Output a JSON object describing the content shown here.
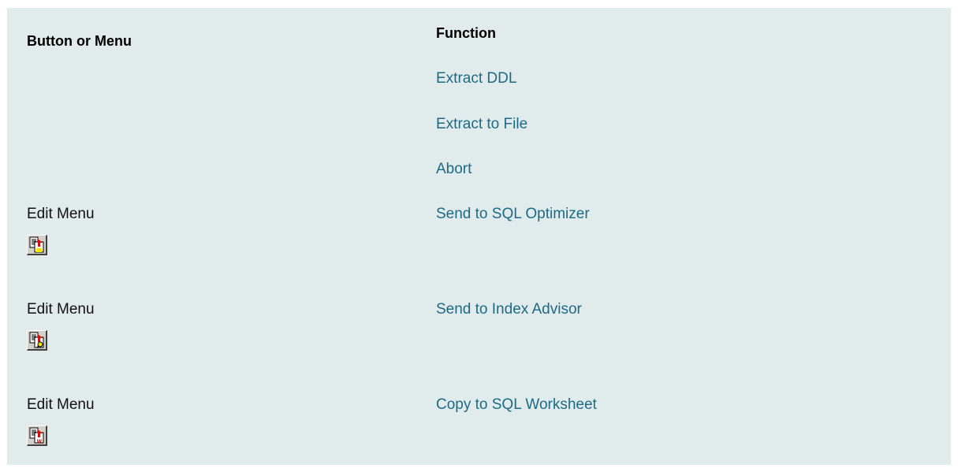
{
  "table": {
    "headers": {
      "button_or_menu": "Button or Menu",
      "function": "Function"
    },
    "rows": [
      {
        "button_or_menu": "",
        "function": "Extract DDL",
        "icon": null
      },
      {
        "button_or_menu": "",
        "function": "Extract to File",
        "icon": null
      },
      {
        "button_or_menu": "",
        "function": "Abort",
        "icon": null
      },
      {
        "button_or_menu": "Edit Menu",
        "function": "Send to SQL Optimizer",
        "icon": "send-to-sql-optimizer-icon",
        "icon_badge": ""
      },
      {
        "button_or_menu": "Edit Menu",
        "function": "Send to Index Advisor",
        "icon": "send-to-index-advisor-icon",
        "icon_badge": ""
      },
      {
        "button_or_menu": "Edit Menu",
        "function": "Copy to SQL Worksheet",
        "icon": "copy-to-sql-worksheet-icon",
        "icon_badge": "W"
      }
    ]
  },
  "colors": {
    "panel_background": "#e1ebeb",
    "link": "#1b6b86",
    "text": "#111111"
  }
}
